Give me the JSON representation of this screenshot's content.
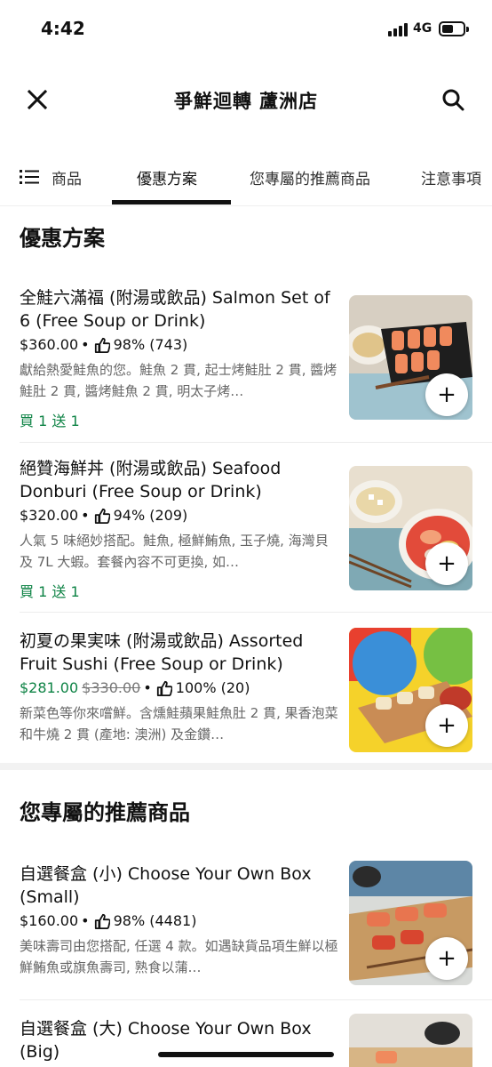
{
  "status_bar": {
    "time": "4:42",
    "network": "4G"
  },
  "header": {
    "title": "爭鮮迴轉 蘆洲店"
  },
  "tabs": [
    {
      "label": "商品"
    },
    {
      "label": "優惠方案"
    },
    {
      "label": "您專屬的推薦商品"
    },
    {
      "label": "注意事項"
    }
  ],
  "sections": [
    {
      "title": "優惠方案",
      "items": [
        {
          "name": "全鮭六滿福 (附湯或飲品) Salmon Set of 6 (Free Soup or Drink)",
          "price": "$360.00",
          "rating": "98% (743)",
          "description": "獻給熱愛鮭魚的您。鮭魚 2 貫, 起士烤鮭肚 2 貫, 醬烤鮭肚 2 貫, 醬烤鮭魚 2 貫, 明太子烤…",
          "promo": "買 1 送 1",
          "add_label": "+"
        },
        {
          "name": "絕贊海鮮丼 (附湯或飲品) Seafood Donburi (Free Soup or Drink)",
          "price": "$320.00",
          "rating": "94% (209)",
          "description": "人氣 5 味絕妙搭配。鮭魚, 極鮮鮪魚, 玉子燒, 海灣貝及 7L 大蝦。套餐內容不可更換, 如…",
          "promo": "買 1 送 1",
          "add_label": "+"
        },
        {
          "name": "初夏の果実味 (附湯或飲品) Assorted Fruit Sushi (Free Soup or Drink)",
          "price": "$281.00",
          "original_price": "$330.00",
          "rating": "100% (20)",
          "description": "新菜色等你來嚐鮮。含燻鮭蘋果鮭魚肚 2 貫, 果香泡菜和牛燒 2 貫 (產地: 澳洲) 及金鑽…",
          "add_label": "+"
        }
      ]
    },
    {
      "title": "您專屬的推薦商品",
      "items": [
        {
          "name": "自選餐盒 (小) Choose Your Own Box (Small)",
          "price": "$160.00",
          "rating": "98% (4481)",
          "description": "美味壽司由您搭配, 任選 4 款。如遇缺貨品項生鮮以極鮮鮪魚或旗魚壽司, 熟食以蒲…",
          "add_label": "+"
        },
        {
          "name": "自選餐盒 (大) Choose Your Own Box (Big)"
        }
      ]
    }
  ],
  "icons": {
    "close": "close-icon",
    "search": "search-icon",
    "menu": "menu-list-icon",
    "thumb": "thumbs-up-icon"
  },
  "colors": {
    "promo_green": "#0e8345",
    "text": "#111111",
    "muted": "#666666"
  }
}
